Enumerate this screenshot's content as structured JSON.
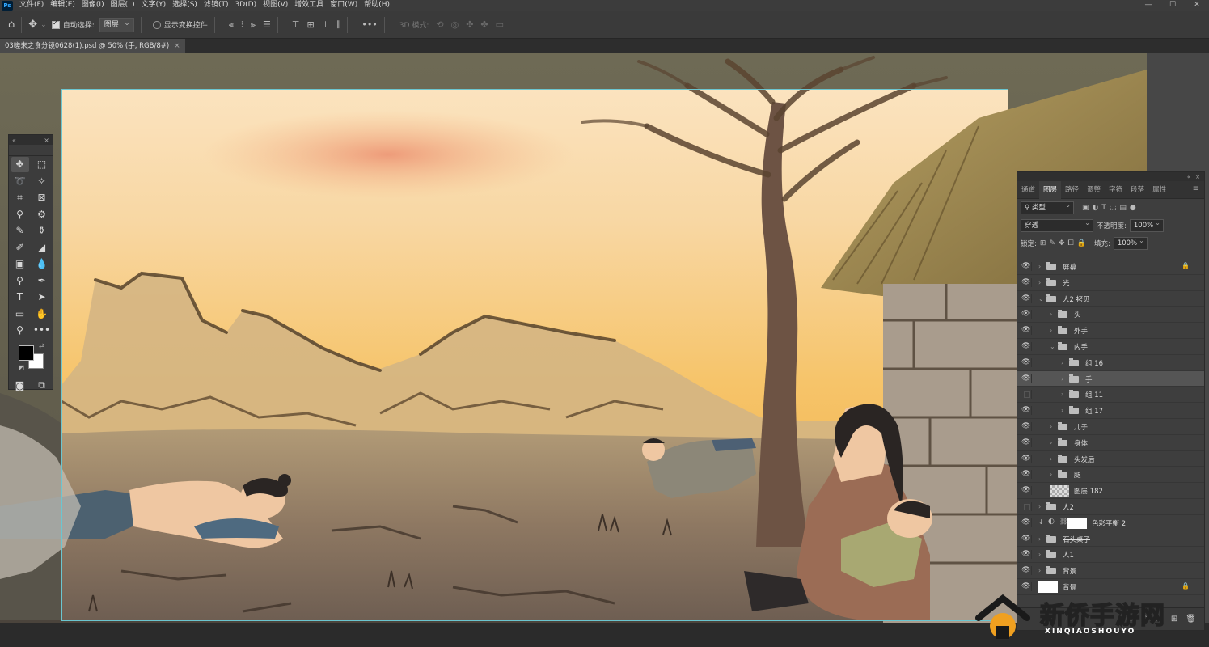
{
  "app": {
    "logo": "Ps"
  },
  "menubar": {
    "items": [
      "文件(F)",
      "编辑(E)",
      "图像(I)",
      "图层(L)",
      "文字(Y)",
      "选择(S)",
      "滤镜(T)",
      "3D(D)",
      "视图(V)",
      "增效工具",
      "窗口(W)",
      "帮助(H)"
    ],
    "window_controls": [
      "—",
      "☐",
      "✕"
    ]
  },
  "options_bar": {
    "home_icon": "home-icon",
    "move_icon": "move-tool-icon",
    "auto_select_label": "自动选择:",
    "auto_select_checked": true,
    "auto_select_target": "图层",
    "show_transform_label": "显示变换控件",
    "more_icon": "•••",
    "mode_3d_label": "3D 模式:"
  },
  "document_tab": {
    "title": "03嗟来之食分镜0628(1).psd @ 50% (手, RGB/8#)",
    "close": "×"
  },
  "toolbox": {
    "collapse": "«",
    "close": "×",
    "tools": [
      [
        "move-tool-icon",
        "marquee-tool-icon"
      ],
      [
        "lasso-tool-icon",
        "magic-wand-tool-icon"
      ],
      [
        "crop-tool-icon",
        "frame-tool-icon"
      ],
      [
        "eyedropper-tool-icon",
        "spot-heal-tool-icon"
      ],
      [
        "brush-tool-icon",
        "clone-stamp-tool-icon"
      ],
      [
        "history-brush-tool-icon",
        "eraser-tool-icon"
      ],
      [
        "gradient-tool-icon",
        "blur-tool-icon"
      ],
      [
        "dodge-tool-icon",
        "pen-tool-icon"
      ],
      [
        "type-tool-icon",
        "path-select-tool-icon"
      ],
      [
        "rectangle-tool-icon",
        "hand-tool-icon"
      ],
      [
        "zoom-tool-icon",
        "more-tools-icon"
      ]
    ],
    "foreground_color": "#000000",
    "background_color": "#ffffff"
  },
  "layers_panel": {
    "header_controls": [
      "«",
      "×"
    ],
    "tabs": [
      "通道",
      "图层",
      "路径",
      "调整",
      "字符",
      "段落",
      "属性"
    ],
    "active_tab": "图层",
    "filter_kind": "类型",
    "blend_mode": "穿透",
    "opacity_label": "不透明度:",
    "opacity_value": "100%",
    "lock_label": "锁定:",
    "fill_label": "填充:",
    "fill_value": "100%",
    "layers": [
      {
        "name": "屏幕",
        "type": "group",
        "depth": 0,
        "visible": true,
        "locked": true,
        "expanded": false
      },
      {
        "name": "光",
        "type": "group",
        "depth": 0,
        "visible": true,
        "expanded": false
      },
      {
        "name": "人2 拷贝",
        "type": "group",
        "depth": 0,
        "visible": true,
        "expanded": true
      },
      {
        "name": "头",
        "type": "group",
        "depth": 1,
        "visible": true,
        "expanded": false
      },
      {
        "name": "外手",
        "type": "group",
        "depth": 1,
        "visible": true,
        "expanded": false
      },
      {
        "name": "内手",
        "type": "group",
        "depth": 1,
        "visible": true,
        "expanded": true
      },
      {
        "name": "组 16",
        "type": "group",
        "depth": 2,
        "visible": true,
        "expanded": false
      },
      {
        "name": "手",
        "type": "group",
        "depth": 2,
        "visible": true,
        "expanded": false,
        "selected": true
      },
      {
        "name": "组 11",
        "type": "group",
        "depth": 2,
        "visible": false,
        "expanded": false
      },
      {
        "name": "组 17",
        "type": "group",
        "depth": 2,
        "visible": true,
        "expanded": false
      },
      {
        "name": "儿子",
        "type": "group",
        "depth": 1,
        "visible": true,
        "expanded": false
      },
      {
        "name": "身体",
        "type": "group",
        "depth": 1,
        "visible": true,
        "expanded": false
      },
      {
        "name": "头发后",
        "type": "group",
        "depth": 1,
        "visible": true,
        "expanded": false
      },
      {
        "name": "腿",
        "type": "group",
        "depth": 1,
        "visible": true,
        "expanded": false
      },
      {
        "name": "图层 182",
        "type": "pixel",
        "depth": 1,
        "visible": true
      },
      {
        "name": "人2",
        "type": "group",
        "depth": 0,
        "visible": false,
        "expanded": false
      },
      {
        "name": "色彩平衡 2",
        "type": "adjustment",
        "depth": 0,
        "visible": true
      },
      {
        "name": "石头桌子",
        "type": "group",
        "depth": 0,
        "visible": true,
        "expanded": false,
        "strikethrough": true
      },
      {
        "name": "人1",
        "type": "group",
        "depth": 0,
        "visible": true,
        "expanded": false
      },
      {
        "name": "背景",
        "type": "group",
        "depth": 0,
        "visible": true,
        "expanded": false
      },
      {
        "name": "背景",
        "type": "background",
        "depth": 0,
        "visible": true,
        "locked": true
      }
    ],
    "bottom_icons": [
      "new-group-icon",
      "adjustment-icon",
      "folder-icon",
      "new-layer-icon",
      "trash-icon"
    ]
  },
  "watermark": {
    "text": "新侨手游网",
    "subtext": "XINQIAOSHOUYO"
  },
  "colors": {
    "menu_bg": "#3c3c3c",
    "panel_bg": "#3e3e3e",
    "canvas_gray": "#535353",
    "artboard_border": "#6bc6d0",
    "watermark_orange": "#f0a020"
  }
}
